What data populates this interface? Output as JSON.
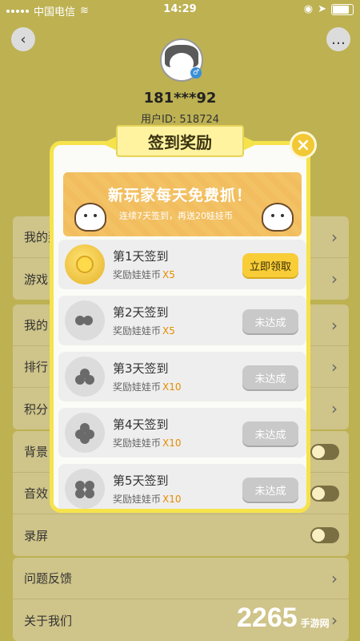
{
  "status": {
    "carrier": "中国电信",
    "time": "14:29"
  },
  "profile": {
    "username": "181***92",
    "user_id": "用户ID: 518724"
  },
  "settings": {
    "group1": [
      "我的奖",
      "游戏"
    ],
    "group2": [
      "我的",
      "排行",
      "积分"
    ],
    "group3": [
      "背景",
      "音效",
      "录屏"
    ],
    "group4": [
      "问题反馈",
      "关于我们"
    ]
  },
  "modal": {
    "title": "签到奖励",
    "close": "×",
    "banner_title": "新玩家每天免费抓！",
    "banner_sub": "连续7天签到，再送20娃娃币",
    "days": [
      {
        "title": "第1天签到",
        "reward": "奖励娃娃币",
        "qty": "X5",
        "button": "立即领取",
        "state": "claim"
      },
      {
        "title": "第2天签到",
        "reward": "奖励娃娃币",
        "qty": "X5",
        "button": "未达成",
        "state": "locked"
      },
      {
        "title": "第3天签到",
        "reward": "奖励娃娃币",
        "qty": "X10",
        "button": "未达成",
        "state": "locked"
      },
      {
        "title": "第4天签到",
        "reward": "奖励娃娃币",
        "qty": "X10",
        "button": "未达成",
        "state": "locked"
      },
      {
        "title": "第5天签到",
        "reward": "奖励娃娃币",
        "qty": "X10",
        "button": "未达成",
        "state": "locked"
      }
    ]
  },
  "watermark": {
    "number": "2265",
    "suffix": "手游网"
  },
  "colors": {
    "accent": "#f6e34c",
    "claim": "#f8cd38",
    "locked": "#c9c9c9",
    "qty": "#e58c00"
  }
}
